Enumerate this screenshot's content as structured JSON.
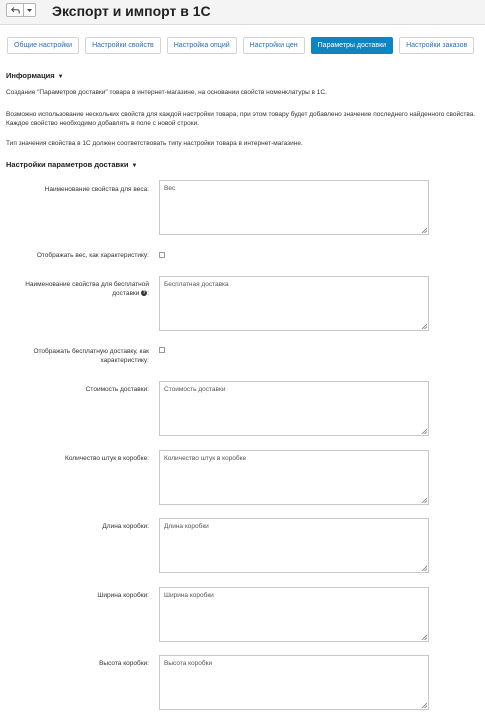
{
  "toolbar": {
    "back_icon": "back-arrow-icon",
    "dropdown_icon": "caret-down-icon",
    "title": "Экспорт и импорт в 1С"
  },
  "tabs": [
    {
      "label": "Общие настройки",
      "active": false
    },
    {
      "label": "Настройки свойств",
      "active": false
    },
    {
      "label": "Настройка опций",
      "active": false
    },
    {
      "label": "Настройки цен",
      "active": false
    },
    {
      "label": "Параметры доставки",
      "active": true
    },
    {
      "label": "Настройки заказов",
      "active": false
    }
  ],
  "info": {
    "title": "Информация",
    "paragraph1": "Создание \"Параметров доставки\" товара в интернет-магазине, на основании свойств номенклатуры в 1С.",
    "paragraph2_line1": "Возможно использование нескольких свойств для каждой настройки товара, при этом товару будет добавлено значение последнего найденного свойства.",
    "paragraph2_line2": "Каждое свойство необходимо добавлять в поле с новой строки.",
    "paragraph3": "Тип значения свойства в 1С должен соответствовать типу настройки товара в интернет-магазине."
  },
  "settings": {
    "title": "Настройки параметров доставки",
    "weight_name": {
      "label": "Наименование свойства для веса:",
      "value": "Вес"
    },
    "show_weight": {
      "label": "Отображать вес, как характеристику:",
      "checked": false
    },
    "free_delivery_name": {
      "label_line1": "Наименование свойства для бесплатной",
      "label_line2": "доставки",
      "label_suffix": ":",
      "value": "Бесплатная доставка"
    },
    "show_free_delivery": {
      "label_line1": "Отображать бесплатную доставку, как",
      "label_line2": "характеристику:",
      "checked": false
    },
    "delivery_cost": {
      "label": "Стоимость доставки:",
      "value": "Стоимость доставки"
    },
    "box_quantity": {
      "label": "Количество штук в коробке:",
      "value": "Количество штук в коробке"
    },
    "box_length": {
      "label": "Длина коробки:",
      "value": "Длина коробки"
    },
    "box_width": {
      "label": "Ширина коробки:",
      "value": "Ширина коробки"
    },
    "box_height": {
      "label": "Высота коробки:",
      "value": "Высота коробки"
    }
  },
  "colors": {
    "accent": "#0f84c3",
    "tab_text": "#2a6fb0"
  }
}
